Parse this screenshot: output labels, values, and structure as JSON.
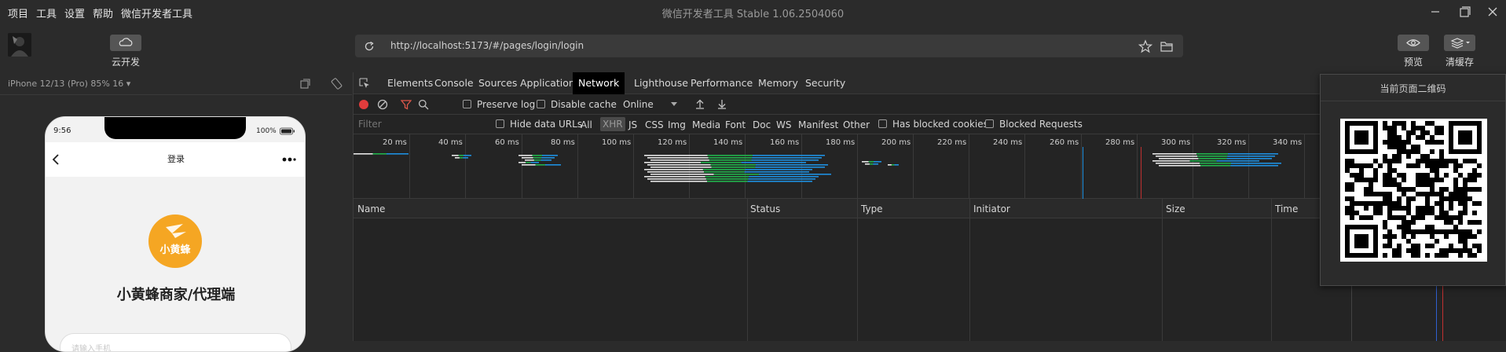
{
  "titlebar": {
    "menus": [
      "项目",
      "工具",
      "设置",
      "帮助",
      "微信开发者工具"
    ],
    "title": "微信开发者工具 Stable 1.06.2504060"
  },
  "toolbar": {
    "cloud_label": "云开发",
    "url": "http://localhost:5173/#/pages/login/login",
    "preview_label": "预览",
    "clear_cache_label": "清缓存"
  },
  "simulator": {
    "device": "iPhone 12/13 (Pro) 85% 16 ▾",
    "status_time": "9:56",
    "battery": "100%",
    "nav_title": "登录",
    "logo_text": "小黄蜂",
    "app_name": "小黄蜂商家/代理端",
    "input_placeholder": "请输入手机"
  },
  "devtools": {
    "tabs": [
      "Elements",
      "Console",
      "Sources",
      "Application",
      "Network",
      "Lighthouse",
      "Performance",
      "Memory",
      "Security"
    ],
    "active_tab": "Network",
    "preserve_log": "Preserve log",
    "disable_cache": "Disable cache",
    "throttle": "Online",
    "filter_placeholder": "Filter",
    "hide_data_urls": "Hide data URLs",
    "type_filters": [
      "All",
      "XHR",
      "JS",
      "CSS",
      "Img",
      "Media",
      "Font",
      "Doc",
      "WS",
      "Manifest",
      "Other"
    ],
    "has_blocked_cookies": "Has blocked cookies",
    "blocked_requests": "Blocked Requests",
    "timeline_ticks": [
      "20 ms",
      "40 ms",
      "60 ms",
      "80 ms",
      "100 ms",
      "120 ms",
      "140 ms",
      "160 ms",
      "180 ms",
      "200 ms",
      "220 ms",
      "240 ms",
      "260 ms",
      "280 ms",
      "300 ms",
      "320 ms",
      "340 ms"
    ],
    "columns": [
      "Name",
      "Status",
      "Type",
      "Initiator",
      "Size",
      "Time"
    ]
  },
  "qr_popup": {
    "title": "当前页面二维码"
  },
  "colors": {
    "accent_record": "#e03c3c",
    "filter_icon": "#e0584b",
    "logo_orange": "#f5a623",
    "bar_blue": "#1e90e0",
    "bar_green": "#22b24c"
  }
}
